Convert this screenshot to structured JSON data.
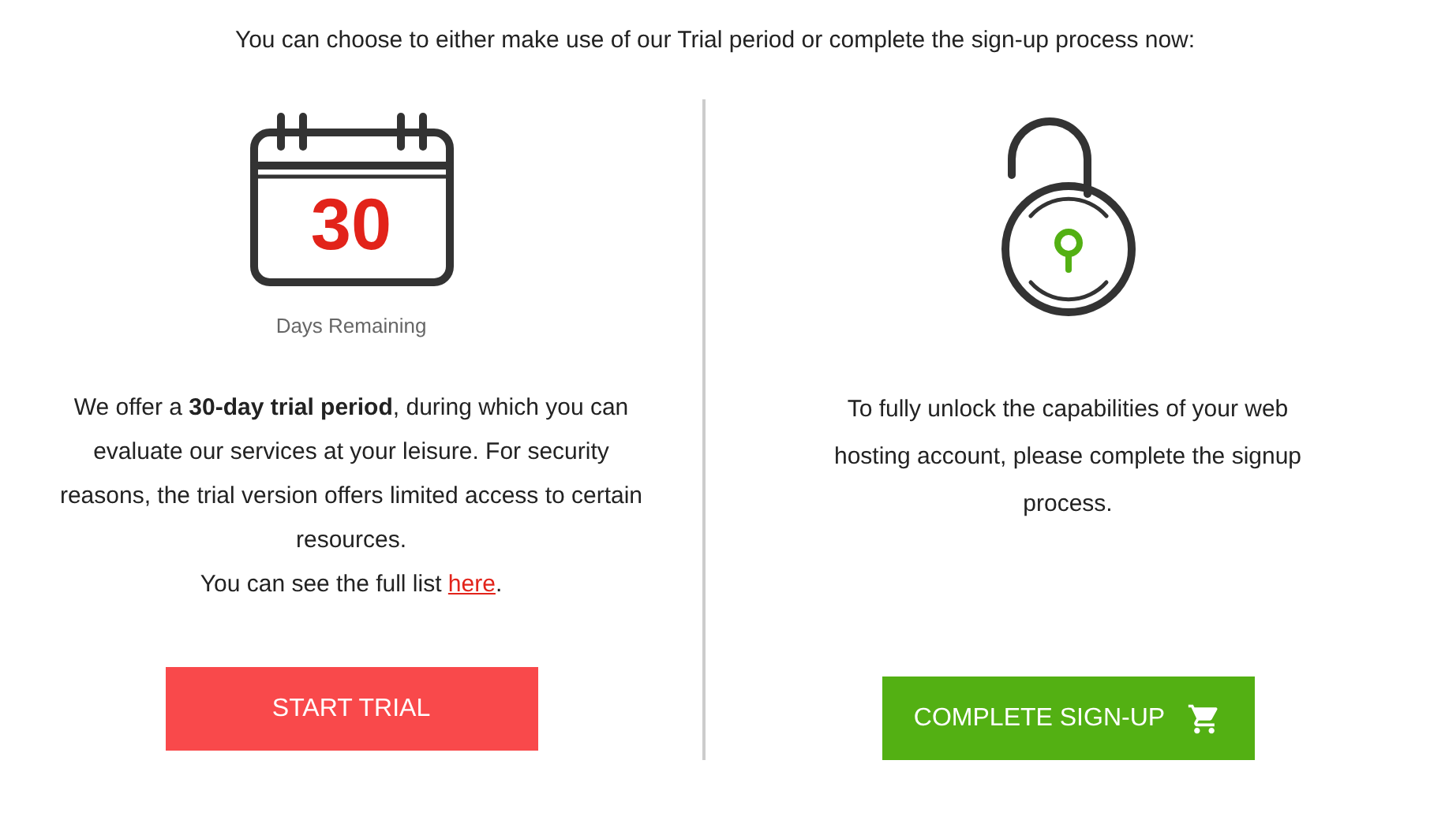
{
  "intro": "You can choose to either make use of our Trial period or complete the sign-up process now:",
  "trial": {
    "day_count": "30",
    "day_caption": "Days Remaining",
    "description": "We offer a **30-day trial period**, during which you can evaluate our services at your leisure. For security reasons, the trial version offers limited access to certain resources.",
    "note_prefix": "You can see the full list ",
    "note_link": "here",
    "note_suffix": ".",
    "button": "START TRIAL"
  },
  "signup": {
    "description": "To fully unlock the capabilities of your web hosting account, please complete the signup process.",
    "button": "COMPLETE SIGN-UP"
  }
}
